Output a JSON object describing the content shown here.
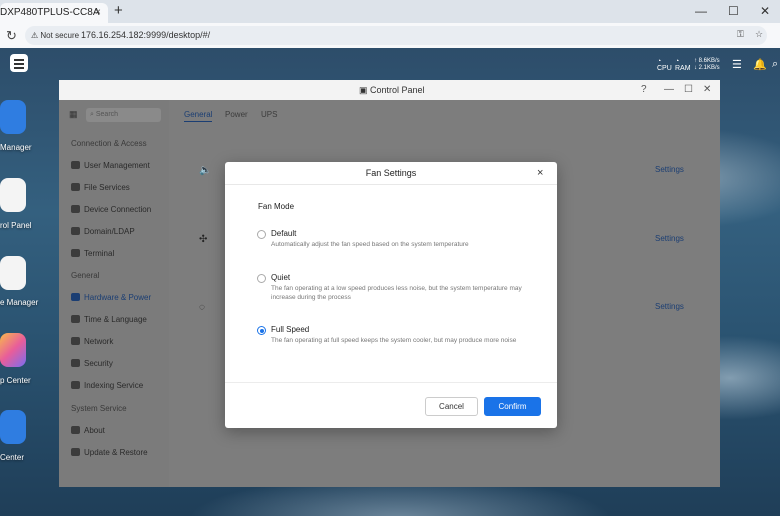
{
  "browser": {
    "tab_title": "DXP480TPLUS-CC8A",
    "tab_close": "×",
    "new_tab": "+",
    "not_secure": "Not secure",
    "url": "176.16.254.182:9999/desktop/#/"
  },
  "topbar": {
    "cpu_label": "CPU",
    "ram_label": "RAM",
    "net_up": "↑ 8.6KB/s",
    "net_down": "↓ 2.1KB/s"
  },
  "desktop_icons": [
    {
      "label": "Manager",
      "color": "#2f7de1"
    },
    {
      "label": "rol Panel",
      "color": "#ffffff"
    },
    {
      "label": "e Manager",
      "color": "#ffffff"
    },
    {
      "label": "p Center",
      "color": "#ffffff"
    },
    {
      "label": "Center",
      "color": "#2f7de1"
    }
  ],
  "control_panel": {
    "title": "Control Panel",
    "help": "?",
    "search_placeholder": "Search",
    "tabs": [
      "General",
      "Power",
      "UPS"
    ],
    "sections": [
      {
        "heading": "Connection & Access",
        "items": [
          "User Management",
          "File Services",
          "Device Connection",
          "Domain/LDAP",
          "Terminal"
        ]
      },
      {
        "heading": "General",
        "items": [
          "Hardware & Power",
          "Time & Language",
          "Network",
          "Security",
          "Indexing Service"
        ]
      },
      {
        "heading": "System Service",
        "items": [
          "About",
          "Update & Restore"
        ]
      }
    ],
    "settings_label": "Settings"
  },
  "modal": {
    "title": "Fan Settings",
    "close": "×",
    "label": "Fan Mode",
    "options": [
      {
        "name": "Default",
        "desc": "Automatically adjust the fan speed based on the system temperature",
        "selected": false
      },
      {
        "name": "Quiet",
        "desc": "The fan operating at a low speed produces less noise, but the system temperature may increase during the process",
        "selected": false
      },
      {
        "name": "Full Speed",
        "desc": "The fan operating at full speed keeps the system cooler, but may produce more noise",
        "selected": true
      }
    ],
    "cancel": "Cancel",
    "confirm": "Confirm"
  },
  "colors": {
    "accent": "#1a73e8",
    "link": "#1b3e73"
  }
}
